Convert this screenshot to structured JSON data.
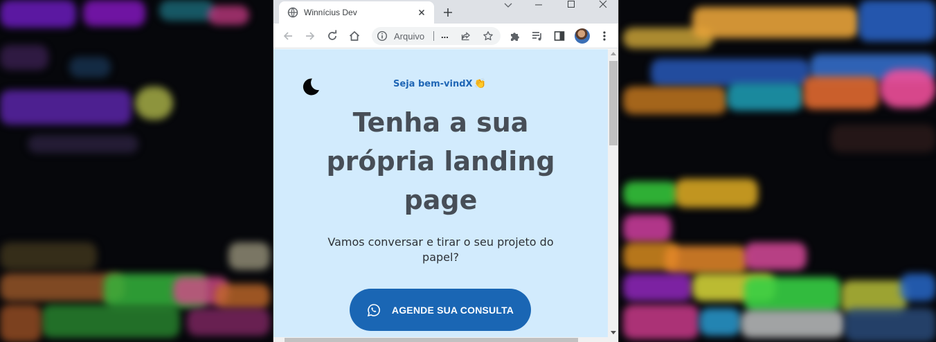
{
  "browser": {
    "tab_title": "Winnícius Dev",
    "omnibox": {
      "scheme_label": "Arquivo",
      "url_text": "..."
    }
  },
  "icons": {
    "favicon": "globe-icon",
    "tab_close": "close-icon",
    "new_tab": "plus-icon",
    "back": "arrow-left-icon",
    "forward": "arrow-right-icon",
    "reload": "reload-icon",
    "home": "home-icon",
    "site_info": "info-icon",
    "share": "share-icon",
    "bookmark": "star-icon",
    "extensions": "puzzle-icon",
    "media": "media-queue-icon",
    "side_panel": "side-panel-icon",
    "menu": "kebab-menu-icon",
    "theme_toggle": "moon-icon",
    "cta": "whatsapp-icon"
  },
  "page": {
    "welcome": "Seja bem-vindX",
    "welcome_emoji": "👏",
    "headline": "Tenha a sua própria landing page",
    "subtitle": "Vamos conversar e tirar o seu projeto do papel?",
    "cta_label": "AGENDE SUA CONSULTA"
  },
  "colors": {
    "page_background": "#d2ebfd",
    "accent": "#1a66b4",
    "headline": "#474e57"
  }
}
